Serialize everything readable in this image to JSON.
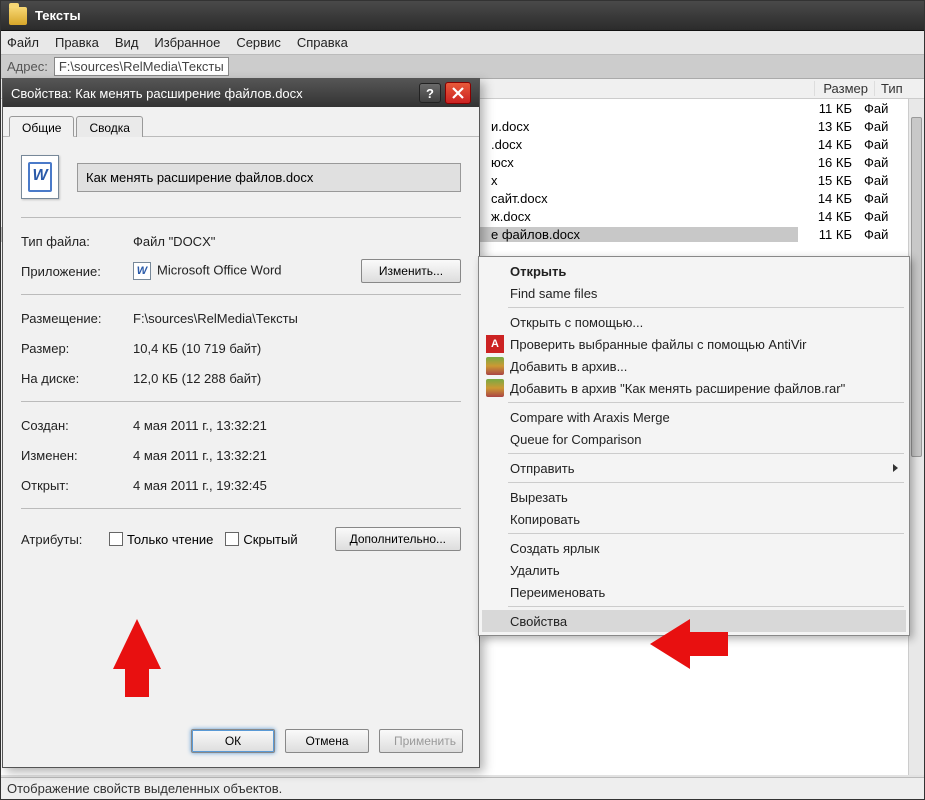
{
  "explorer": {
    "title": "Тексты",
    "menu": {
      "file": "Файл",
      "edit": "Правка",
      "view": "Вид",
      "favorites": "Избранное",
      "service": "Сервис",
      "help": "Справка"
    },
    "address_label": "Адрес:",
    "address_path": "F:\\sources\\RelMedia\\Тексты",
    "columns": {
      "name": "",
      "size": "Размер",
      "type": "Тип"
    },
    "files": [
      {
        "name": "",
        "size": "11 КБ",
        "type": "Фай"
      },
      {
        "name": "и.docx",
        "size": "13 КБ",
        "type": "Фай"
      },
      {
        "name": ".docx",
        "size": "14 КБ",
        "type": "Фай"
      },
      {
        "name": "юсx",
        "size": "16 КБ",
        "type": "Фай"
      },
      {
        "name": "х",
        "size": "15 КБ",
        "type": "Фай"
      },
      {
        "name": "сайт.docx",
        "size": "14 КБ",
        "type": "Фай"
      },
      {
        "name": "ж.docx",
        "size": "14 КБ",
        "type": "Фай"
      },
      {
        "name": "е файлов.docx",
        "size": "11 КБ",
        "type": "Фай",
        "selected": true
      }
    ],
    "statusbar": "Отображение свойств выделенных объектов."
  },
  "properties": {
    "title": "Свойства: Как менять расширение файлов.docx",
    "tabs": {
      "general": "Общие",
      "summary": "Сводка"
    },
    "filename": "Как менять расширение файлов.docx",
    "labels": {
      "type": "Тип файла:",
      "app": "Приложение:",
      "location": "Размещение:",
      "size": "Размер:",
      "disk": "На диске:",
      "created": "Создан:",
      "modified": "Изменен:",
      "opened": "Открыт:",
      "attrs": "Атрибуты:"
    },
    "values": {
      "type": "Файл \"DOCX\"",
      "app": "Microsoft Office Word",
      "location": "F:\\sources\\RelMedia\\Тексты",
      "size": "10,4 КБ (10 719 байт)",
      "disk": "12,0 КБ (12 288 байт)",
      "created": "4 мая 2011 г., 13:32:21",
      "modified": "4 мая 2011 г., 13:32:21",
      "opened": "4 мая 2011 г., 19:32:45"
    },
    "change_btn": "Изменить...",
    "attr_readonly": "Только чтение",
    "attr_hidden": "Скрытый",
    "advanced_btn": "Дополнительно...",
    "ok": "ОК",
    "cancel": "Отмена",
    "apply": "Применить"
  },
  "context_menu": {
    "open": "Открыть",
    "find_same": "Find same files",
    "open_with": "Открыть с помощью...",
    "antivir": "Проверить выбранные файлы с помощью AntiVir",
    "add_archive": "Добавить в архив...",
    "add_archive_rar": "Добавить в архив \"Как менять расширение файлов.rar\"",
    "araxis_compare": "Compare with Araxis Merge",
    "araxis_queue": "Queue for Comparison",
    "send_to": "Отправить",
    "cut": "Вырезать",
    "copy": "Копировать",
    "create_shortcut": "Создать ярлык",
    "delete": "Удалить",
    "rename": "Переименовать",
    "properties": "Свойства"
  }
}
